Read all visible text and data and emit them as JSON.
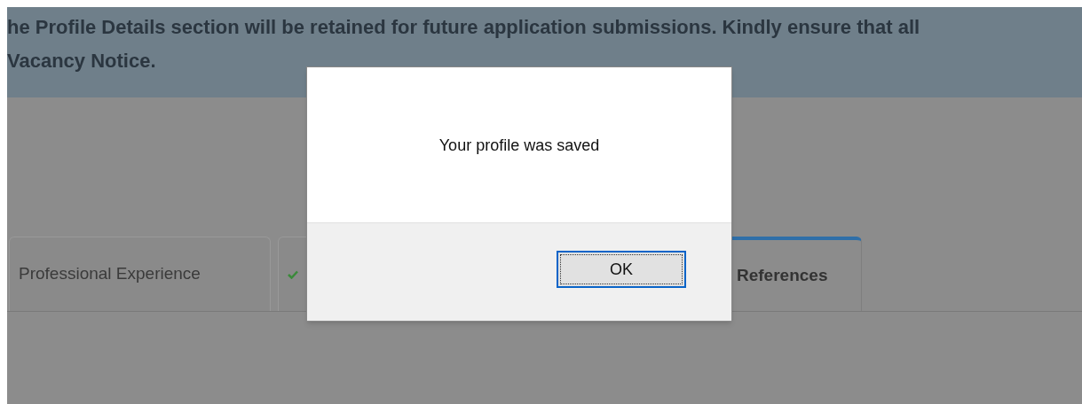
{
  "banner": {
    "lines": [
      "he Profile Details section will be retained for future application submissions. Kindly ensure that all",
      "Vacancy Notice."
    ]
  },
  "tabs": [
    {
      "label": "Professional Experience",
      "selected": false,
      "complete": false
    },
    {
      "selected": false,
      "complete": true
    },
    {
      "label": "References",
      "selected": true,
      "complete": false
    }
  ],
  "dialog": {
    "message": "Your profile was saved",
    "button": "OK"
  }
}
